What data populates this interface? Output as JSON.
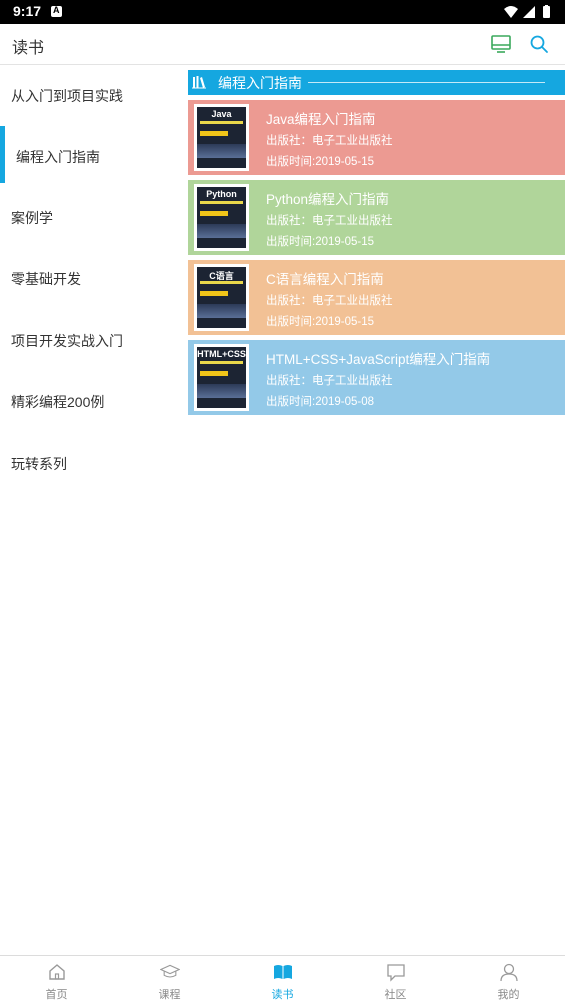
{
  "status_bar": {
    "time": "9:17",
    "notification_glyph": "A"
  },
  "header": {
    "title": "读书",
    "icons": [
      "monitor-icon",
      "search-icon"
    ],
    "accent_color": "#15a7e0"
  },
  "sidebar": {
    "items": [
      {
        "label": "从入门到项目实践",
        "active": false
      },
      {
        "label": "编程入门指南",
        "active": true
      },
      {
        "label": "案例学",
        "active": false
      },
      {
        "label": "零基础开发",
        "active": false
      },
      {
        "label": "项目开发实战入门",
        "active": false
      },
      {
        "label": "精彩编程200例",
        "active": false
      },
      {
        "label": "玩转系列",
        "active": false
      }
    ]
  },
  "section": {
    "title": "编程入门指南",
    "icon": "books-icon"
  },
  "books": [
    {
      "title": "Java编程入门指南",
      "publisher": "出版社：电子工业出版社",
      "date": "出版时间:2019-05-15",
      "bg": "#ec9a92",
      "cover_title": "Java"
    },
    {
      "title": "Python编程入门指南",
      "publisher": "出版社：电子工业出版社",
      "date": "出版时间:2019-05-15",
      "bg": "#b0d59a",
      "cover_title": "Python"
    },
    {
      "title": "C语言编程入门指南",
      "publisher": "出版社：电子工业出版社",
      "date": "出版时间:2019-05-15",
      "bg": "#f2c195",
      "cover_title": "C语言"
    },
    {
      "title": "HTML+CSS+JavaScript编程入门指南",
      "publisher": "出版社：电子工业出版社",
      "date": "出版时间:2019-05-08",
      "bg": "#93c9e8",
      "cover_title": "HTML+CSS"
    }
  ],
  "tabbar": {
    "tabs": [
      {
        "label": "首页",
        "icon": "home-icon",
        "active": false
      },
      {
        "label": "课程",
        "icon": "graduation-cap-icon",
        "active": false
      },
      {
        "label": "读书",
        "icon": "open-book-icon",
        "active": true
      },
      {
        "label": "社区",
        "icon": "chat-bubble-icon",
        "active": false
      },
      {
        "label": "我的",
        "icon": "user-icon",
        "active": false
      }
    ]
  }
}
